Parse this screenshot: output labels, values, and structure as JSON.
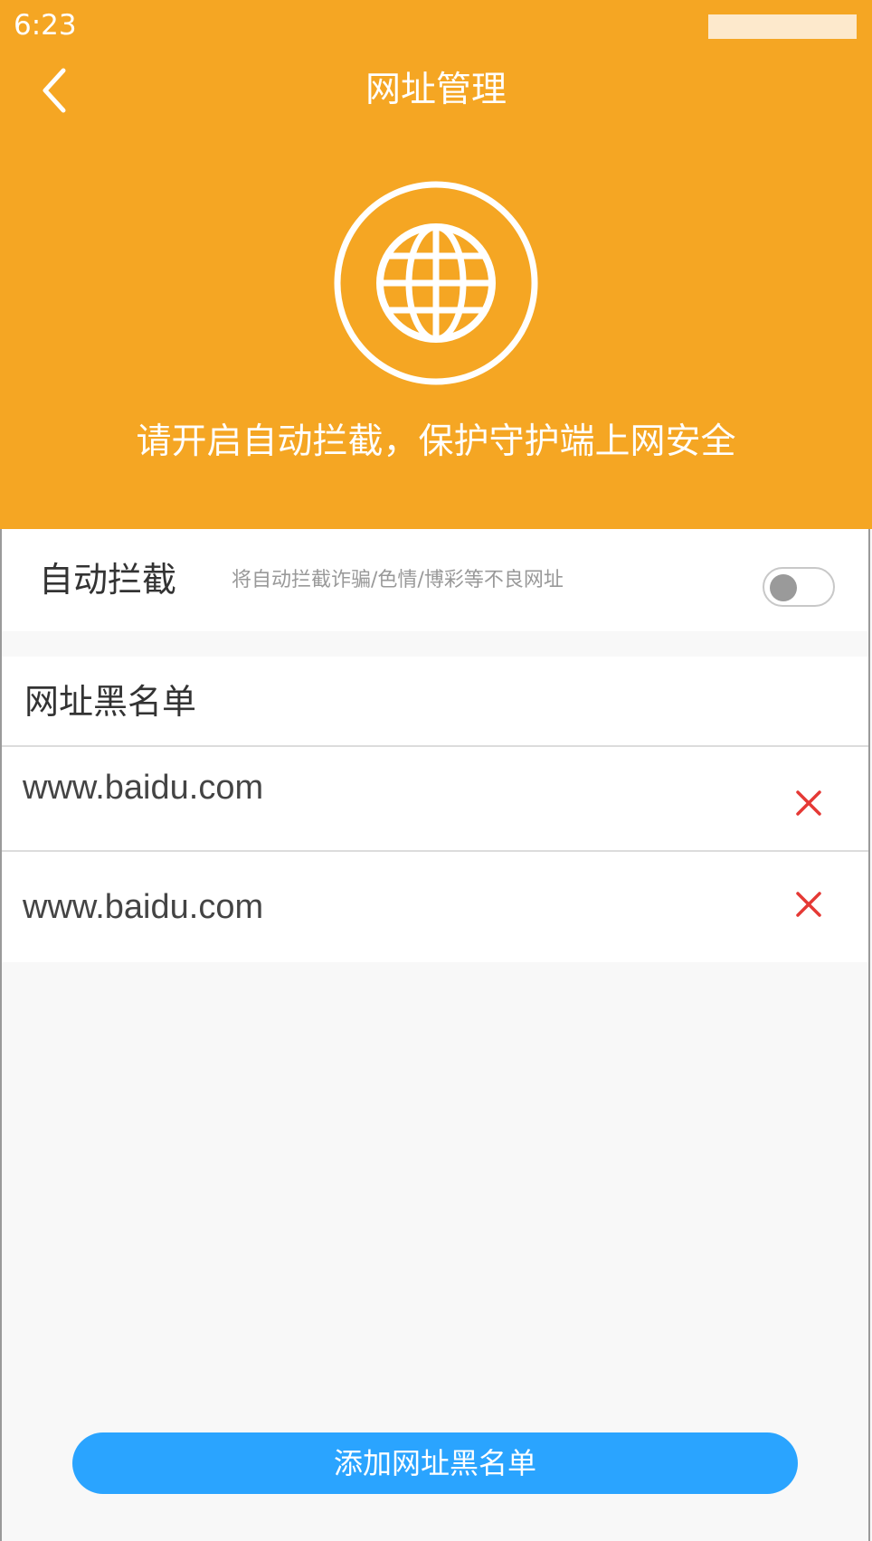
{
  "status_bar": {
    "time": "6:23"
  },
  "header": {
    "title": "网址管理",
    "banner_text": "请开启自动拦截，保护守护端上网安全",
    "background_color": "#F5A623"
  },
  "auto_block": {
    "label": "自动拦截",
    "description": "将自动拦截诈骗/色情/博彩等不良网址",
    "enabled": false
  },
  "blacklist": {
    "title": "网址黑名单",
    "items": [
      {
        "url": "www.baidu.com"
      },
      {
        "url": "www.baidu.com"
      }
    ]
  },
  "add_button": {
    "label": "添加网址黑名单",
    "color": "#2AA4FF"
  },
  "icons": {
    "back": "chevron-left-icon",
    "globe": "globe-icon",
    "delete": "close-icon"
  },
  "colors": {
    "delete_icon": "#E53935"
  }
}
